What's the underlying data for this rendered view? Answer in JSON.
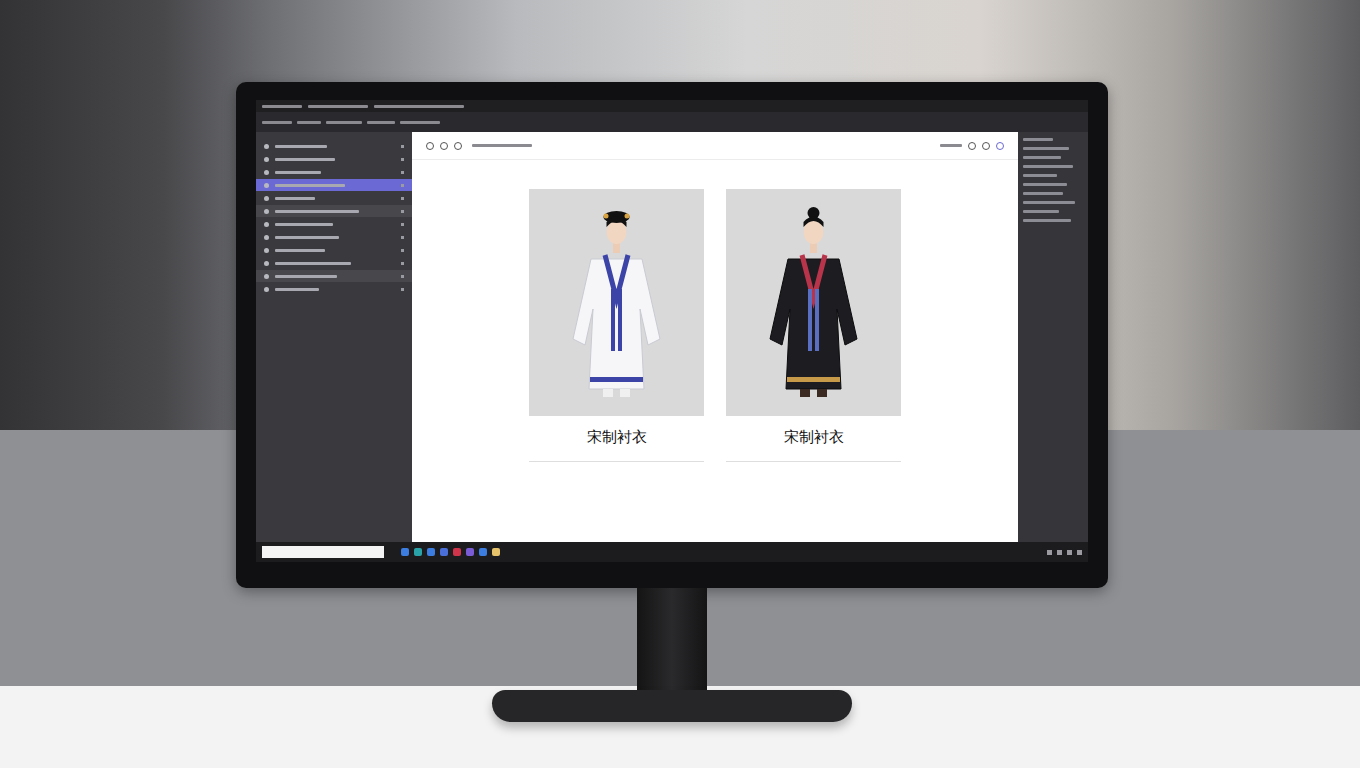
{
  "sidebar": {
    "items": [
      {
        "selected": false
      },
      {
        "selected": false
      },
      {
        "selected": false
      },
      {
        "selected": true
      },
      {
        "selected": false
      },
      {
        "selected": false
      },
      {
        "selected": false
      },
      {
        "selected": false
      },
      {
        "selected": false
      },
      {
        "selected": false
      },
      {
        "selected": false
      },
      {
        "selected": false
      }
    ]
  },
  "gallery": {
    "cards": [
      {
        "label": "宋制衬衣",
        "kind": "light"
      },
      {
        "label": "宋制衬衣",
        "kind": "dark"
      }
    ]
  },
  "taskbar": {
    "apps": [
      {
        "color": "#3b7de0"
      },
      {
        "color": "#2aa3a8"
      },
      {
        "color": "#3b7de0"
      },
      {
        "color": "#4a6fd8"
      },
      {
        "color": "#d0344a"
      },
      {
        "color": "#7a5cd6"
      },
      {
        "color": "#3b7de0"
      },
      {
        "color": "#e6c36a"
      }
    ]
  }
}
